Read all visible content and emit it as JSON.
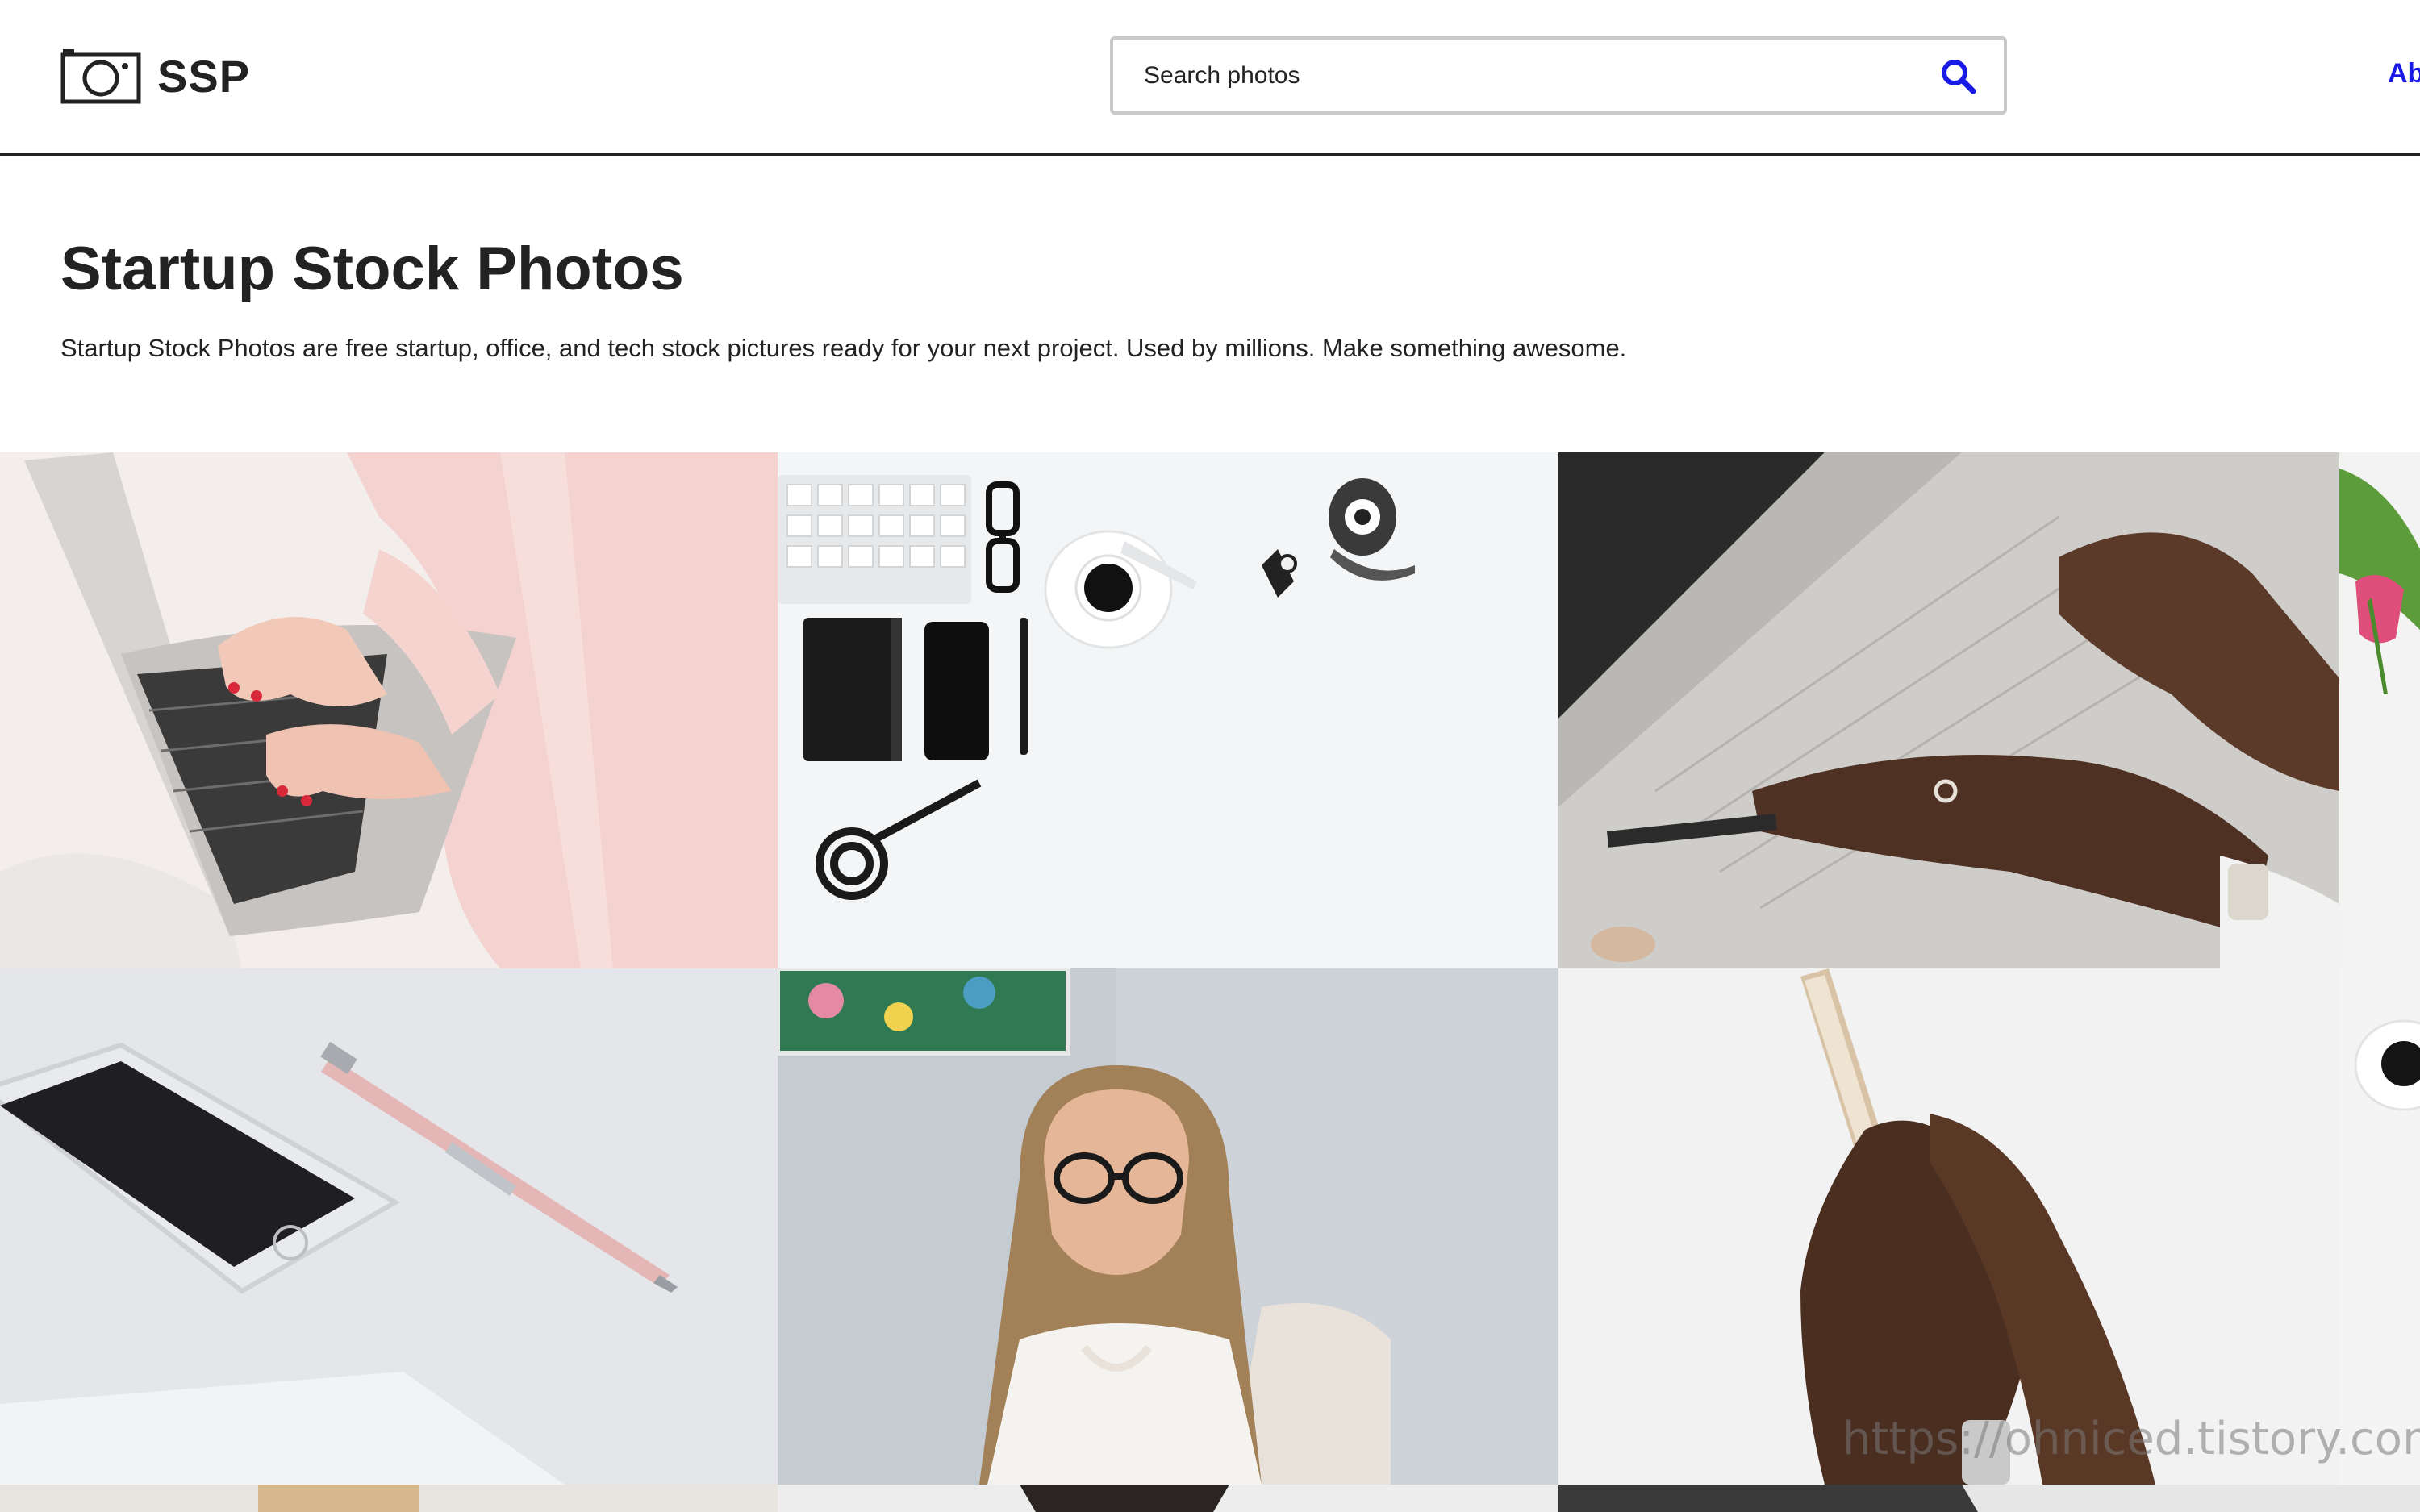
{
  "header": {
    "logo_text": "SSP",
    "search": {
      "placeholder": "Search photos"
    },
    "nav_about": "Ab"
  },
  "hero": {
    "title": "Startup Stock Photos",
    "description": "Startup Stock Photos are free startup, office, and tech stock pictures ready for your next project. Used by millions. Make something awesome."
  },
  "photos": [
    {
      "subject": "woman typing on laptop in pink shirt"
    },
    {
      "subject": "flat lay keyboard, glasses, coffee, notebook, phone, scissors"
    },
    {
      "subject": "hands typing on silver laptop"
    },
    {
      "subject": "pink tulips"
    },
    {
      "subject": "white smartphone and pink pen"
    },
    {
      "subject": "woman with glasses looking down"
    },
    {
      "subject": "hands holding gold smartphone"
    },
    {
      "subject": "coffee cup"
    }
  ],
  "watermark": "https://ohniced.tistory.com",
  "colors": {
    "accent": "#1a1ae6",
    "text": "#222222",
    "search_border": "#c9c9c9"
  },
  "icons": {
    "logo": "camera-icon",
    "search": "search-icon"
  }
}
